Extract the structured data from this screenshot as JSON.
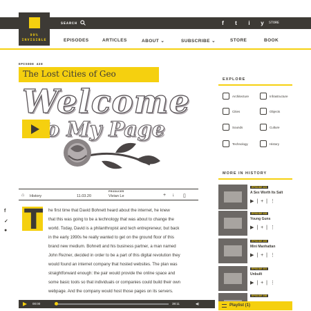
{
  "header": {
    "logo_line1": "99%",
    "logo_line2": "INVISIBLE",
    "search_label": "SEARCH",
    "social": [
      "f",
      "t",
      "i",
      "y"
    ],
    "store_label": "STORE"
  },
  "nav": {
    "items": [
      "EPISODES",
      "ARTICLES",
      "ABOUT ⌄",
      "SUBSCRIBE ⌄",
      "STORE",
      "BOOK"
    ]
  },
  "episode": {
    "label": "EPISODE 428",
    "title": "The Lost Cities of Geo",
    "hero_line1": "Welcome",
    "hero_line2": "To My Page",
    "meta": {
      "category_label": "",
      "category": "History",
      "date": "11.03.20",
      "producer_label": "PRODUCER",
      "producer": "Vivian Le"
    }
  },
  "article": {
    "dropcap": "T",
    "lines": [
      "he first time that David Bohnett heard about the internet, he knew",
      "that this was going to be a technology that was about to change the",
      "world. Today, David is a philanthropist and tech entrepreneur, but back",
      "in the early 1990s he really wanted to get on the ground floor of this",
      "brand new medium. Bohnett and his business partner, a man named",
      "John Rezner, decided in order to be a part of this digital revolution they",
      "would found an internet company that hosted websites. The plan was",
      "straightforward enough: the pair would provide the online space and",
      "some basic tools so that individuals or companies could build their own",
      "webpage. And the company would host those pages on its servers."
    ]
  },
  "player": {
    "current": "00:00",
    "remaining": "38:11"
  },
  "explore": {
    "heading": "EXPLORE",
    "categories": [
      "Architecture",
      "Infrastructure",
      "Cities",
      "Objects",
      "Sounds",
      "Culture",
      "Technology",
      "History"
    ]
  },
  "history": {
    "heading": "MORE IN HISTORY",
    "items": [
      {
        "episode": "EPISODE 421",
        "title": "A Sex Worth Its Salt"
      },
      {
        "episode": "EPISODE 416",
        "title": "Young Guns"
      },
      {
        "episode": "EPISODE 409",
        "title": "Mini Manhattan"
      },
      {
        "episode": "EPISODE 401",
        "title": "Unbuilt"
      },
      {
        "episode": "EPISODE 398",
        "title": ""
      }
    ],
    "controls": "▶ | + | ⋮"
  },
  "playlist": {
    "label": "Playlist (1)"
  },
  "colors": {
    "accent": "#f5d00f",
    "dark": "#3d3a35"
  }
}
